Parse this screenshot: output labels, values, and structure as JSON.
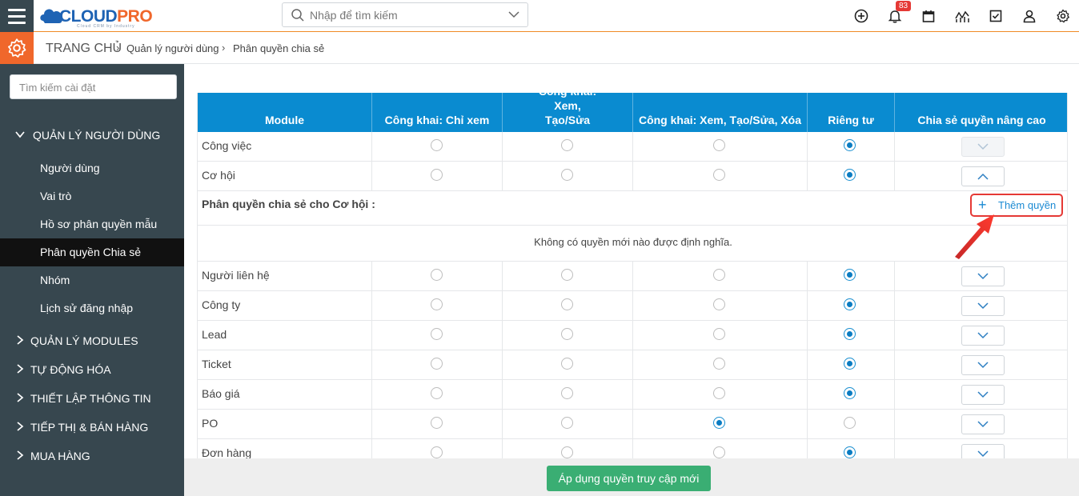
{
  "app": {
    "logo_text_1": "CLOUD",
    "logo_text_2": "PRO",
    "logo_tagline": "Cloud CRM by Industry",
    "brand_blue": "#1e63b4",
    "brand_orange": "#f0672b"
  },
  "header": {
    "search_placeholder": "Nhập để tìm kiếm",
    "notification_count": "83",
    "icons": [
      "add-circle-icon",
      "bell-icon",
      "calendar-icon",
      "chart-icon",
      "checkbox-icon",
      "user-icon",
      "gear-icon"
    ]
  },
  "breadcrumb": {
    "home": "TRANG CHỦ",
    "level1": "Quản lý người dùng",
    "level2": "Phân quyền chia sẻ"
  },
  "sidebar": {
    "search_placeholder": "Tìm kiếm cài đặt",
    "sections": [
      {
        "label": "QUẢN LÝ NGƯỜI DÙNG",
        "expanded": true
      },
      {
        "label": "QUẢN LÝ MODULES"
      },
      {
        "label": "TỰ ĐỘNG HÓA"
      },
      {
        "label": "THIẾT LẬP THÔNG TIN"
      },
      {
        "label": "TIẾP THỊ & BÁN HÀNG"
      },
      {
        "label": "MUA HÀNG"
      }
    ],
    "items": [
      {
        "label": "Người dùng"
      },
      {
        "label": "Vai trò"
      },
      {
        "label": "Hồ sơ phân quyền mẫu"
      },
      {
        "label": "Phân quyền Chia sẻ",
        "active": true
      },
      {
        "label": "Nhóm"
      },
      {
        "label": "Lịch sử đăng nhập"
      }
    ]
  },
  "table": {
    "headers": [
      "Module",
      "Công khai: Chỉ xem",
      "Công khai: Xem, Tạo/Sửa",
      "Công khai: Xem, Tạo/Sửa, Xóa",
      "Riêng tư",
      "Chia sẻ quyền nâng cao"
    ],
    "rows": [
      {
        "module": "Công việc",
        "selected": 3,
        "toggle": "down",
        "disabled": true
      },
      {
        "module": "Cơ hội",
        "selected": 3,
        "toggle": "up"
      },
      {
        "module": "Người liên hệ",
        "selected": 3,
        "toggle": "down"
      },
      {
        "module": "Công ty",
        "selected": 3,
        "toggle": "down"
      },
      {
        "module": "Lead",
        "selected": 3,
        "toggle": "down"
      },
      {
        "module": "Ticket",
        "selected": 3,
        "toggle": "down"
      },
      {
        "module": "Báo giá",
        "selected": 3,
        "toggle": "down"
      },
      {
        "module": "PO",
        "selected": 2,
        "toggle": "down"
      },
      {
        "module": "Đơn hàng",
        "selected": 3,
        "toggle": "down"
      }
    ],
    "share_title": "Phân quyền chia sẻ cho Cơ hội :",
    "add_permission_label": "Thêm quyền",
    "empty_message": "Không có quyền mới nào được định nghĩa."
  },
  "footer": {
    "apply_label": "Áp dụng quyền truy cập mới"
  },
  "colors": {
    "sidebar_bg": "#37474f",
    "table_header_bg": "#0a8bd0",
    "apply_button": "#3aae73",
    "annotation_red": "#e53935"
  }
}
